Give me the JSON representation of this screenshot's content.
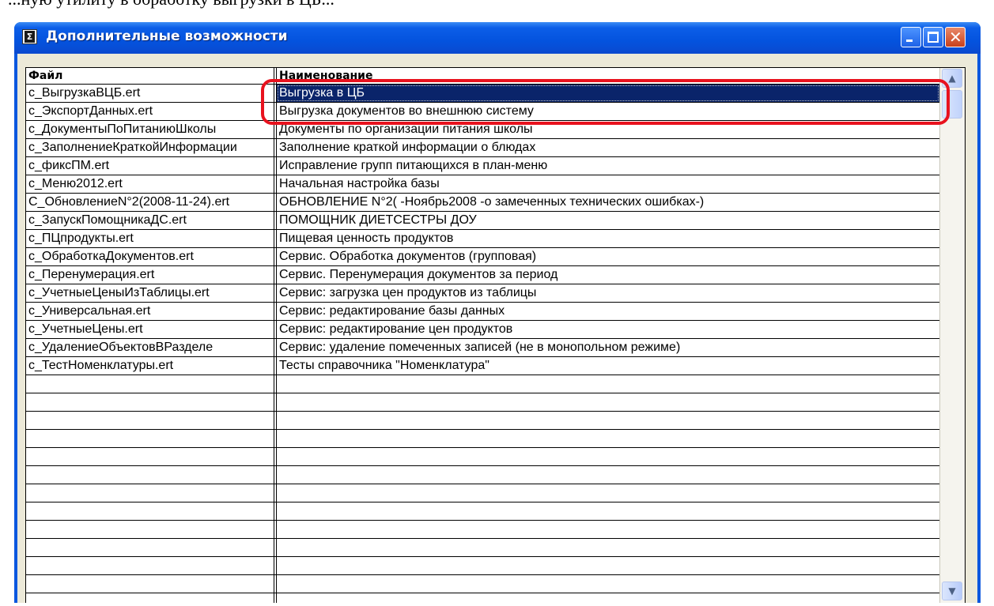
{
  "document_text": "...ную утилиту в обработку выгрузки в ЦБ...",
  "window": {
    "title": "Дополнительные возможности",
    "app_icon_glyph": "Σ",
    "title_color": "#0a57df",
    "close_color": "#c8401c"
  },
  "columns": {
    "file": "Файл",
    "name": "Наименование"
  },
  "rows": [
    {
      "file": "c_ВыгрузкаВЦБ.ert",
      "name": "Выгрузка в ЦБ",
      "selected": true
    },
    {
      "file": "c_ЭкспортДанных.ert",
      "name": "Выгрузка документов во внешнюю систему"
    },
    {
      "file": "c_ДокументыПоПитаниюШколы",
      "name": "Документы по организации питания школы"
    },
    {
      "file": "c_ЗаполнениеКраткойИнформации",
      "name": "Заполнение краткой информации о блюдах"
    },
    {
      "file": "c_фиксПМ.ert",
      "name": "Исправление групп питающихся в план-меню"
    },
    {
      "file": "c_Меню2012.ert",
      "name": "Начальная настройка базы"
    },
    {
      "file": "C_ОбновлениеN°2(2008-11-24).ert",
      "name": "ОБНОВЛЕНИЕ N°2( -Ноябрь2008 -о замеченных технических ошибках-)"
    },
    {
      "file": "c_ЗапускПомощникаДС.ert",
      "name": "ПОМОЩНИК ДИЕТСЕСТРЫ ДОУ"
    },
    {
      "file": "c_ПЦпродукты.ert",
      "name": "Пищевая ценность продуктов"
    },
    {
      "file": "c_ОбработкаДокументов.ert",
      "name": "Сервис. Обработка документов (групповая)"
    },
    {
      "file": "c_Перенумерация.ert",
      "name": "Сервис. Перенумерация документов за период"
    },
    {
      "file": "c_УчетныеЦеныИзТаблицы.ert",
      "name": "Сервис: загрузка цен продуктов из таблицы"
    },
    {
      "file": "c_Универсальная.ert",
      "name": "Сервис: редактирование базы данных"
    },
    {
      "file": "c_УчетныеЦены.ert",
      "name": "Сервис: редактирование цен продуктов"
    },
    {
      "file": "c_УдалениеОбъектовВРазделе",
      "name": "Сервис: удаление помеченных записей (не в монопольном режиме)"
    },
    {
      "file": "c_ТестНоменклатуры.ert",
      "name": "Тесты справочника \"Номенклатура\""
    }
  ],
  "scrollbar": {
    "up_icon": "▲",
    "down_icon": "▼"
  },
  "highlight_color": "#e8121e"
}
